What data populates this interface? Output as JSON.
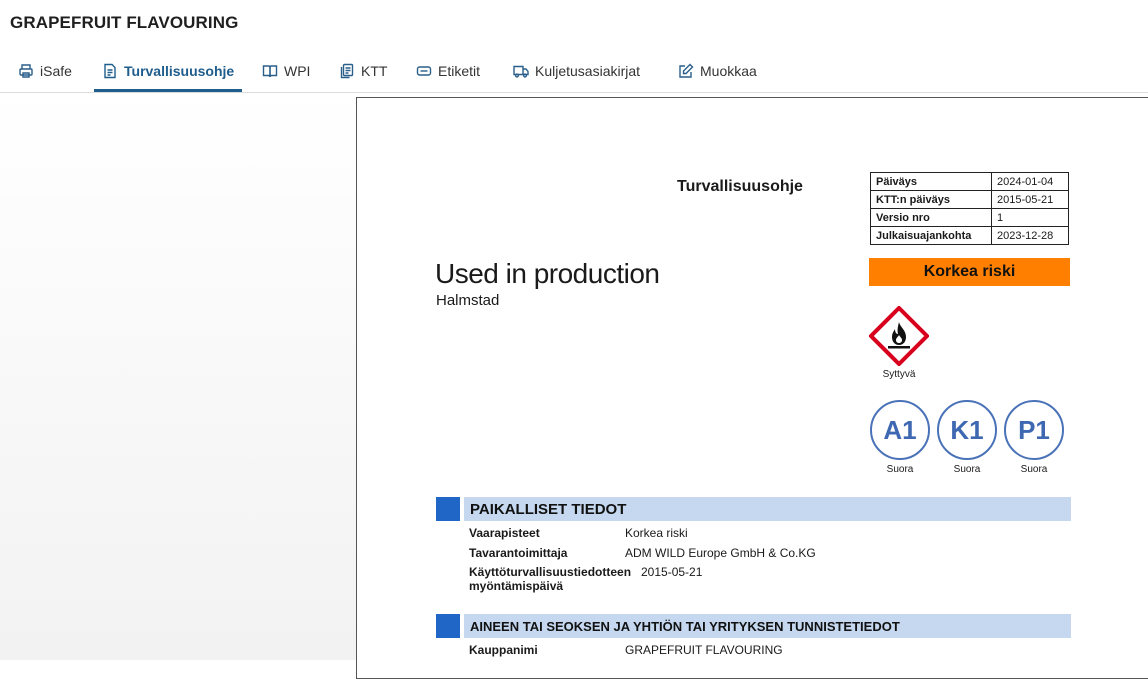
{
  "app": {
    "title": "GRAPEFRUIT FLAVOURING"
  },
  "tabs": [
    {
      "label": "iSafe",
      "icon": "printer-icon"
    },
    {
      "label": "Turvallisuusohje",
      "icon": "document-icon",
      "active": true
    },
    {
      "label": "WPI",
      "icon": "book-icon"
    },
    {
      "label": "KTT",
      "icon": "copy-icon"
    },
    {
      "label": "Etiketit",
      "icon": "label-icon"
    },
    {
      "label": "Kuljetusasiakirjat",
      "icon": "truck-icon"
    },
    {
      "label": "Muokkaa",
      "icon": "edit-icon"
    }
  ],
  "document": {
    "heading": "Turvallisuusohje",
    "info": [
      {
        "key": "Päiväys",
        "value": "2024-01-04"
      },
      {
        "key": "KTT:n päiväys",
        "value": "2015-05-21"
      },
      {
        "key": "Versio nro",
        "value": "1"
      },
      {
        "key": "Julkaisuajankohta",
        "value": "2023-12-28"
      }
    ],
    "risk_label": "Korkea riski",
    "risk_color": "#ff8000",
    "product_name": "Used in production",
    "location": "Halmstad",
    "hazard": {
      "icon": "flame-pictogram-icon",
      "caption": "Syttyvä"
    },
    "ratings": [
      {
        "code": "A1",
        "caption": "Suora"
      },
      {
        "code": "K1",
        "caption": "Suora"
      },
      {
        "code": "P1",
        "caption": "Suora"
      }
    ],
    "section1": {
      "title": "PAIKALLISET TIEDOT",
      "rows": [
        {
          "key": "Vaarapisteet",
          "value": "Korkea riski"
        },
        {
          "key": "Tavarantoimittaja",
          "value": "ADM WILD Europe GmbH & Co.KG"
        },
        {
          "key": "Käyttöturvallisuustiedotteen myöntämispäivä",
          "value": "2015-05-21"
        }
      ]
    },
    "section2": {
      "title": "AINEEN TAI SEOKSEN JA YHTIÖN TAI YRITYKSEN TUNNISTETIEDOT",
      "rows": [
        {
          "key": "Kauppanimi",
          "value": "GRAPEFRUIT FLAVOURING"
        }
      ]
    }
  }
}
